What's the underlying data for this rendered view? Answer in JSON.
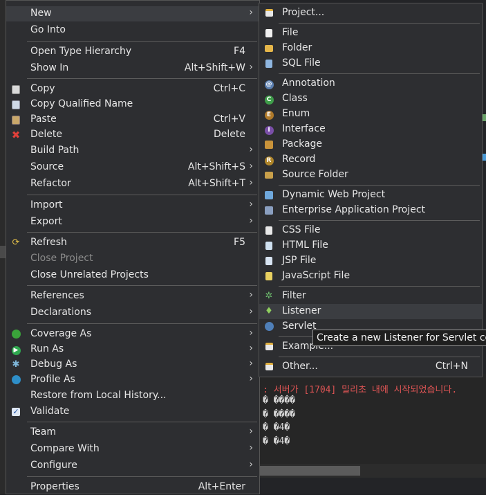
{
  "main_menu": {
    "items": [
      {
        "label": "New",
        "accel": "",
        "submenu": true,
        "icon": ""
      },
      {
        "label": "Go Into",
        "accel": "",
        "submenu": false,
        "icon": ""
      },
      {
        "label": "Open Type Hierarchy",
        "accel": "F4",
        "submenu": false,
        "icon": ""
      },
      {
        "label": "Show In",
        "accel": "Alt+Shift+W",
        "submenu": true,
        "icon": ""
      },
      {
        "label": "Copy",
        "accel": "Ctrl+C",
        "submenu": false,
        "icon": "copy-icon"
      },
      {
        "label": "Copy Qualified Name",
        "accel": "",
        "submenu": false,
        "icon": "copy-qualified-icon"
      },
      {
        "label": "Paste",
        "accel": "Ctrl+V",
        "submenu": false,
        "icon": "paste-icon"
      },
      {
        "label": "Delete",
        "accel": "Delete",
        "submenu": false,
        "icon": "delete-icon"
      },
      {
        "label": "Build Path",
        "accel": "",
        "submenu": true,
        "icon": ""
      },
      {
        "label": "Source",
        "accel": "Alt+Shift+S",
        "submenu": true,
        "icon": ""
      },
      {
        "label": "Refactor",
        "accel": "Alt+Shift+T",
        "submenu": true,
        "icon": ""
      },
      {
        "label": "Import",
        "accel": "",
        "submenu": true,
        "icon": ""
      },
      {
        "label": "Export",
        "accel": "",
        "submenu": true,
        "icon": ""
      },
      {
        "label": "Refresh",
        "accel": "F5",
        "submenu": false,
        "icon": "refresh-icon"
      },
      {
        "label": "Close Project",
        "accel": "",
        "submenu": false,
        "icon": "",
        "disabled": true
      },
      {
        "label": "Close Unrelated Projects",
        "accel": "",
        "submenu": false,
        "icon": ""
      },
      {
        "label": "References",
        "accel": "",
        "submenu": true,
        "icon": ""
      },
      {
        "label": "Declarations",
        "accel": "",
        "submenu": true,
        "icon": ""
      },
      {
        "label": "Coverage As",
        "accel": "",
        "submenu": true,
        "icon": "coverage-icon"
      },
      {
        "label": "Run As",
        "accel": "",
        "submenu": true,
        "icon": "run-icon"
      },
      {
        "label": "Debug As",
        "accel": "",
        "submenu": true,
        "icon": "debug-icon"
      },
      {
        "label": "Profile As",
        "accel": "",
        "submenu": true,
        "icon": "profile-icon"
      },
      {
        "label": "Restore from Local History...",
        "accel": "",
        "submenu": false,
        "icon": ""
      },
      {
        "label": "Validate",
        "accel": "",
        "submenu": false,
        "icon": "check-icon"
      },
      {
        "label": "Team",
        "accel": "",
        "submenu": true,
        "icon": ""
      },
      {
        "label": "Compare With",
        "accel": "",
        "submenu": true,
        "icon": ""
      },
      {
        "label": "Configure",
        "accel": "",
        "submenu": true,
        "icon": ""
      },
      {
        "label": "Properties",
        "accel": "Alt+Enter",
        "submenu": false,
        "icon": ""
      }
    ]
  },
  "new_submenu": {
    "items": [
      {
        "label": "Project...",
        "icon": "project-icon"
      },
      {
        "label": "File",
        "icon": "file-icon"
      },
      {
        "label": "Folder",
        "icon": "folder-icon"
      },
      {
        "label": "SQL File",
        "icon": "sql-file-icon"
      },
      {
        "label": "Annotation",
        "icon": "annotation-icon"
      },
      {
        "label": "Class",
        "icon": "class-icon"
      },
      {
        "label": "Enum",
        "icon": "enum-icon"
      },
      {
        "label": "Interface",
        "icon": "interface-icon"
      },
      {
        "label": "Package",
        "icon": "package-icon"
      },
      {
        "label": "Record",
        "icon": "record-icon"
      },
      {
        "label": "Source Folder",
        "icon": "source-folder-icon"
      },
      {
        "label": "Dynamic Web Project",
        "icon": "web-project-icon"
      },
      {
        "label": "Enterprise Application Project",
        "icon": "ear-project-icon"
      },
      {
        "label": "CSS File",
        "icon": "css-file-icon"
      },
      {
        "label": "HTML File",
        "icon": "html-file-icon"
      },
      {
        "label": "JSP File",
        "icon": "jsp-file-icon"
      },
      {
        "label": "JavaScript File",
        "icon": "js-file-icon"
      },
      {
        "label": "Filter",
        "icon": "filter-icon"
      },
      {
        "label": "Listener",
        "icon": "listener-icon"
      },
      {
        "label": "Servlet",
        "icon": "servlet-icon"
      },
      {
        "label": "Example...",
        "icon": "example-icon"
      },
      {
        "label": "Other...",
        "accel": "Ctrl+N",
        "icon": "other-icon"
      }
    ]
  },
  "tooltip": "Create a new Listener for Servlet cor",
  "console": {
    "line1": ": 서버가 [1704] 밀리초 내에 시작되었습니다.",
    "line2": "� ����",
    "line3": "� ����",
    "line4": "� �4�",
    "line5": "� �4�"
  },
  "colors": {
    "menu_bg": "#2d2e31",
    "highlight": "#3b3d41",
    "console_error": "#e05555"
  }
}
